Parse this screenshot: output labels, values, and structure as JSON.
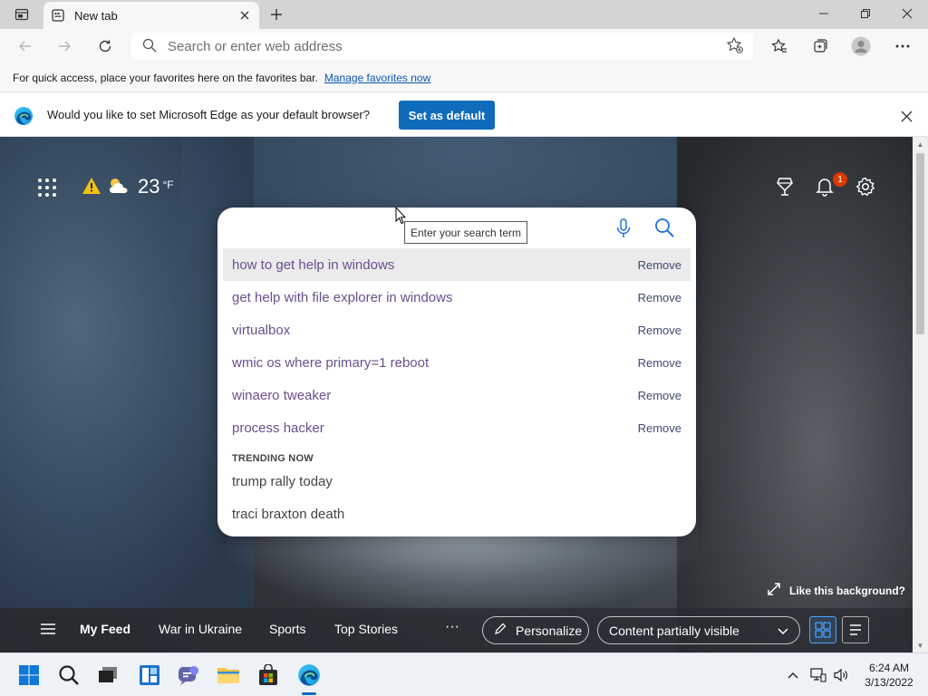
{
  "browser": {
    "tab": {
      "title": "New tab"
    },
    "address_bar": {
      "placeholder": "Search or enter web address"
    }
  },
  "favorites_bar": {
    "message": "For quick access, place your favorites here on the favorites bar.",
    "link": "Manage favorites now"
  },
  "infobar": {
    "message": "Would you like to set Microsoft Edge as your default browser?",
    "button": "Set as default"
  },
  "weather": {
    "icons": [
      "warning-icon",
      "partly-cloudy-icon"
    ],
    "temp": "23",
    "unit": "°F"
  },
  "notifications": {
    "count": "1"
  },
  "search": {
    "tooltip": "Enter your search term",
    "history": [
      {
        "text": "how to get help in windows",
        "action": "Remove"
      },
      {
        "text": "get help with file explorer in windows",
        "action": "Remove"
      },
      {
        "text": "virtualbox",
        "action": "Remove"
      },
      {
        "text": "wmic os where primary=1 reboot",
        "action": "Remove"
      },
      {
        "text": "winaero tweaker",
        "action": "Remove"
      },
      {
        "text": "process hacker",
        "action": "Remove"
      }
    ],
    "trending_heading": "TRENDING NOW",
    "trending": [
      "trump rally today",
      "traci braxton death"
    ]
  },
  "background": {
    "like_label": "Like this background?"
  },
  "feed": {
    "items": [
      "My Feed",
      "War in Ukraine",
      "Sports",
      "Top Stories"
    ],
    "more": "···",
    "personalize": "Personalize",
    "visibility": "Content partially visible"
  },
  "taskbar": {
    "icons": [
      "windows-start-icon",
      "search-icon",
      "task-view-icon",
      "widgets-icon",
      "chat-icon",
      "file-explorer-icon",
      "store-icon",
      "edge-icon"
    ],
    "time": "6:24 AM",
    "date": "3/13/2022"
  },
  "colors": {
    "accent": "#0f6cbd",
    "history_link": "#6b4f8e",
    "badge": "#d83b01"
  }
}
